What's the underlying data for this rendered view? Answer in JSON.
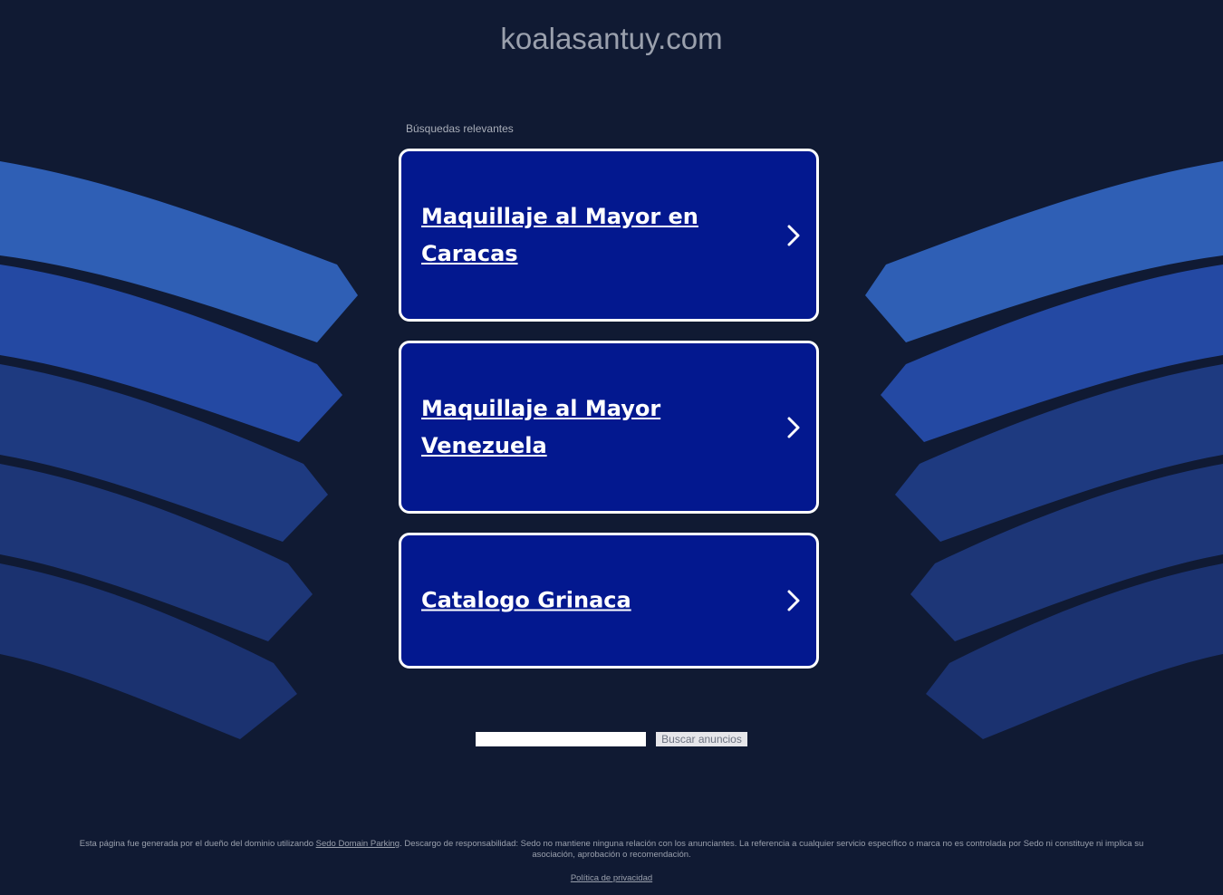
{
  "header": {
    "domain": "koalasantuy.com"
  },
  "related": {
    "label": "Búsquedas relevantes",
    "items": [
      {
        "label": "Maquillaje al Mayor en Caracas"
      },
      {
        "label": "Maquillaje al Mayor Venezuela"
      },
      {
        "label": "Catalogo Grinaca"
      }
    ]
  },
  "search": {
    "value": "",
    "placeholder": "",
    "button_label": "Buscar anuncios"
  },
  "footer": {
    "text_before": "Esta página fue generada por el dueño del dominio utilizando ",
    "link_label": "Sedo Domain Parking",
    "text_after": ". Descargo de responsabilidad: Sedo no mantiene ninguna relación con los anunciantes. La referencia a cualquier servicio específico o marca no es controlada por Sedo ni constituye ni implica su asociación, aprobación o recomendación.",
    "privacy_label": "Política de privacidad"
  },
  "colors": {
    "background": "#101a33",
    "card": "#03188f",
    "band_light": "#2f5fb5",
    "band_mid": "#2449a3",
    "band_dark": "#1e3a80"
  }
}
